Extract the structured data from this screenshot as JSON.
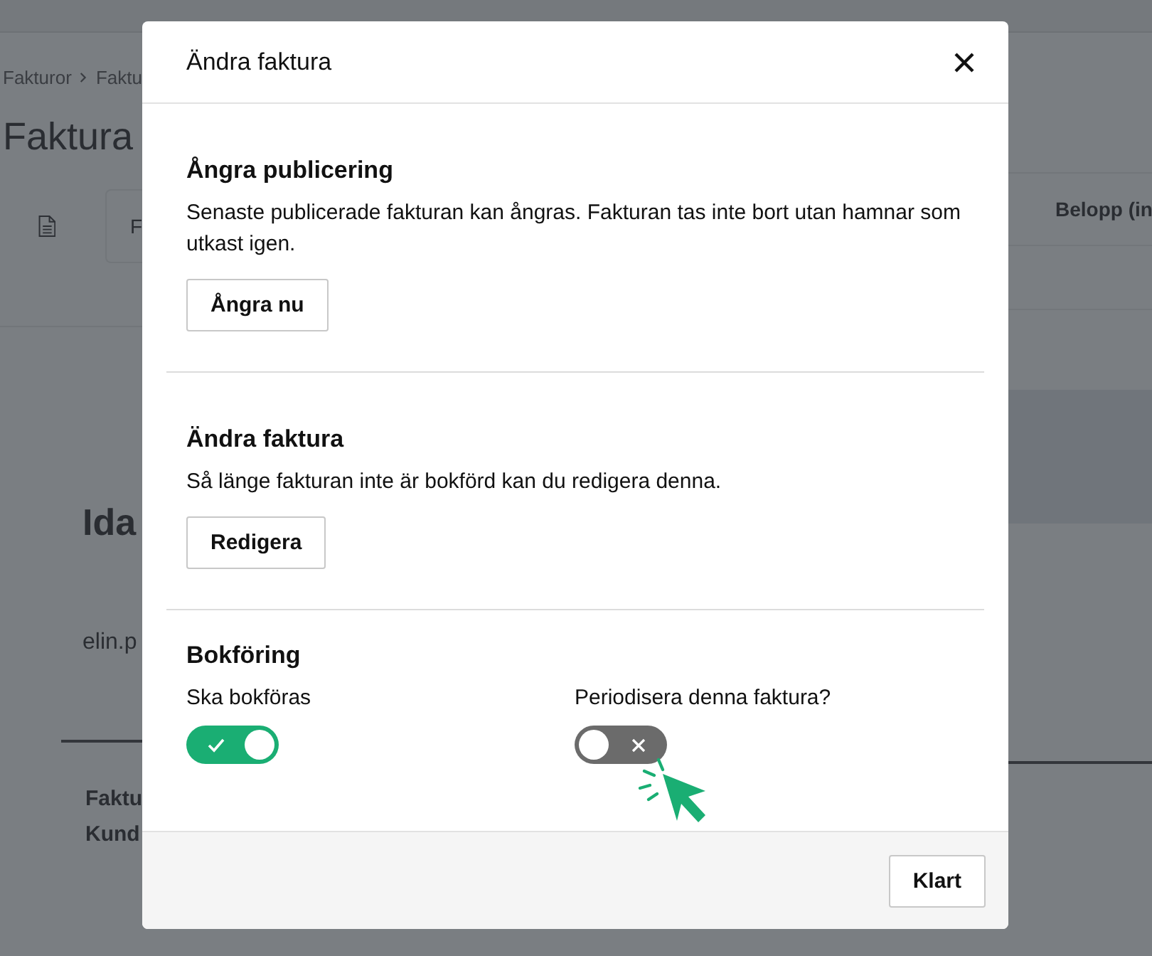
{
  "background": {
    "breadcrumb": [
      {
        "label": "Fakturor"
      },
      {
        "label": "Faktu"
      }
    ],
    "title": "Faktura",
    "tab_label": "F",
    "column_heading": "Belopp (in",
    "customer_name": "Ida",
    "email": "elin.p",
    "footer_labels": [
      "Faktu",
      "Kund"
    ]
  },
  "dialog": {
    "title": "Ändra faktura",
    "sections": [
      {
        "kind": "action",
        "heading": "Ångra publicering",
        "text": "Senaste publicerade fakturan kan ångras. Fakturan tas inte bort utan hamnar som utkast igen.",
        "button": "Ångra nu"
      },
      {
        "kind": "action",
        "heading": "Ändra faktura",
        "text": "Så länge fakturan inte är bokförd kan du redigera denna.",
        "button": "Redigera"
      },
      {
        "kind": "toggles",
        "heading": "Bokföring",
        "toggles": [
          {
            "label": "Ska bokföras",
            "on": true
          },
          {
            "label": "Periodisera denna faktura?",
            "on": false
          }
        ]
      }
    ],
    "done_button": "Klart"
  }
}
